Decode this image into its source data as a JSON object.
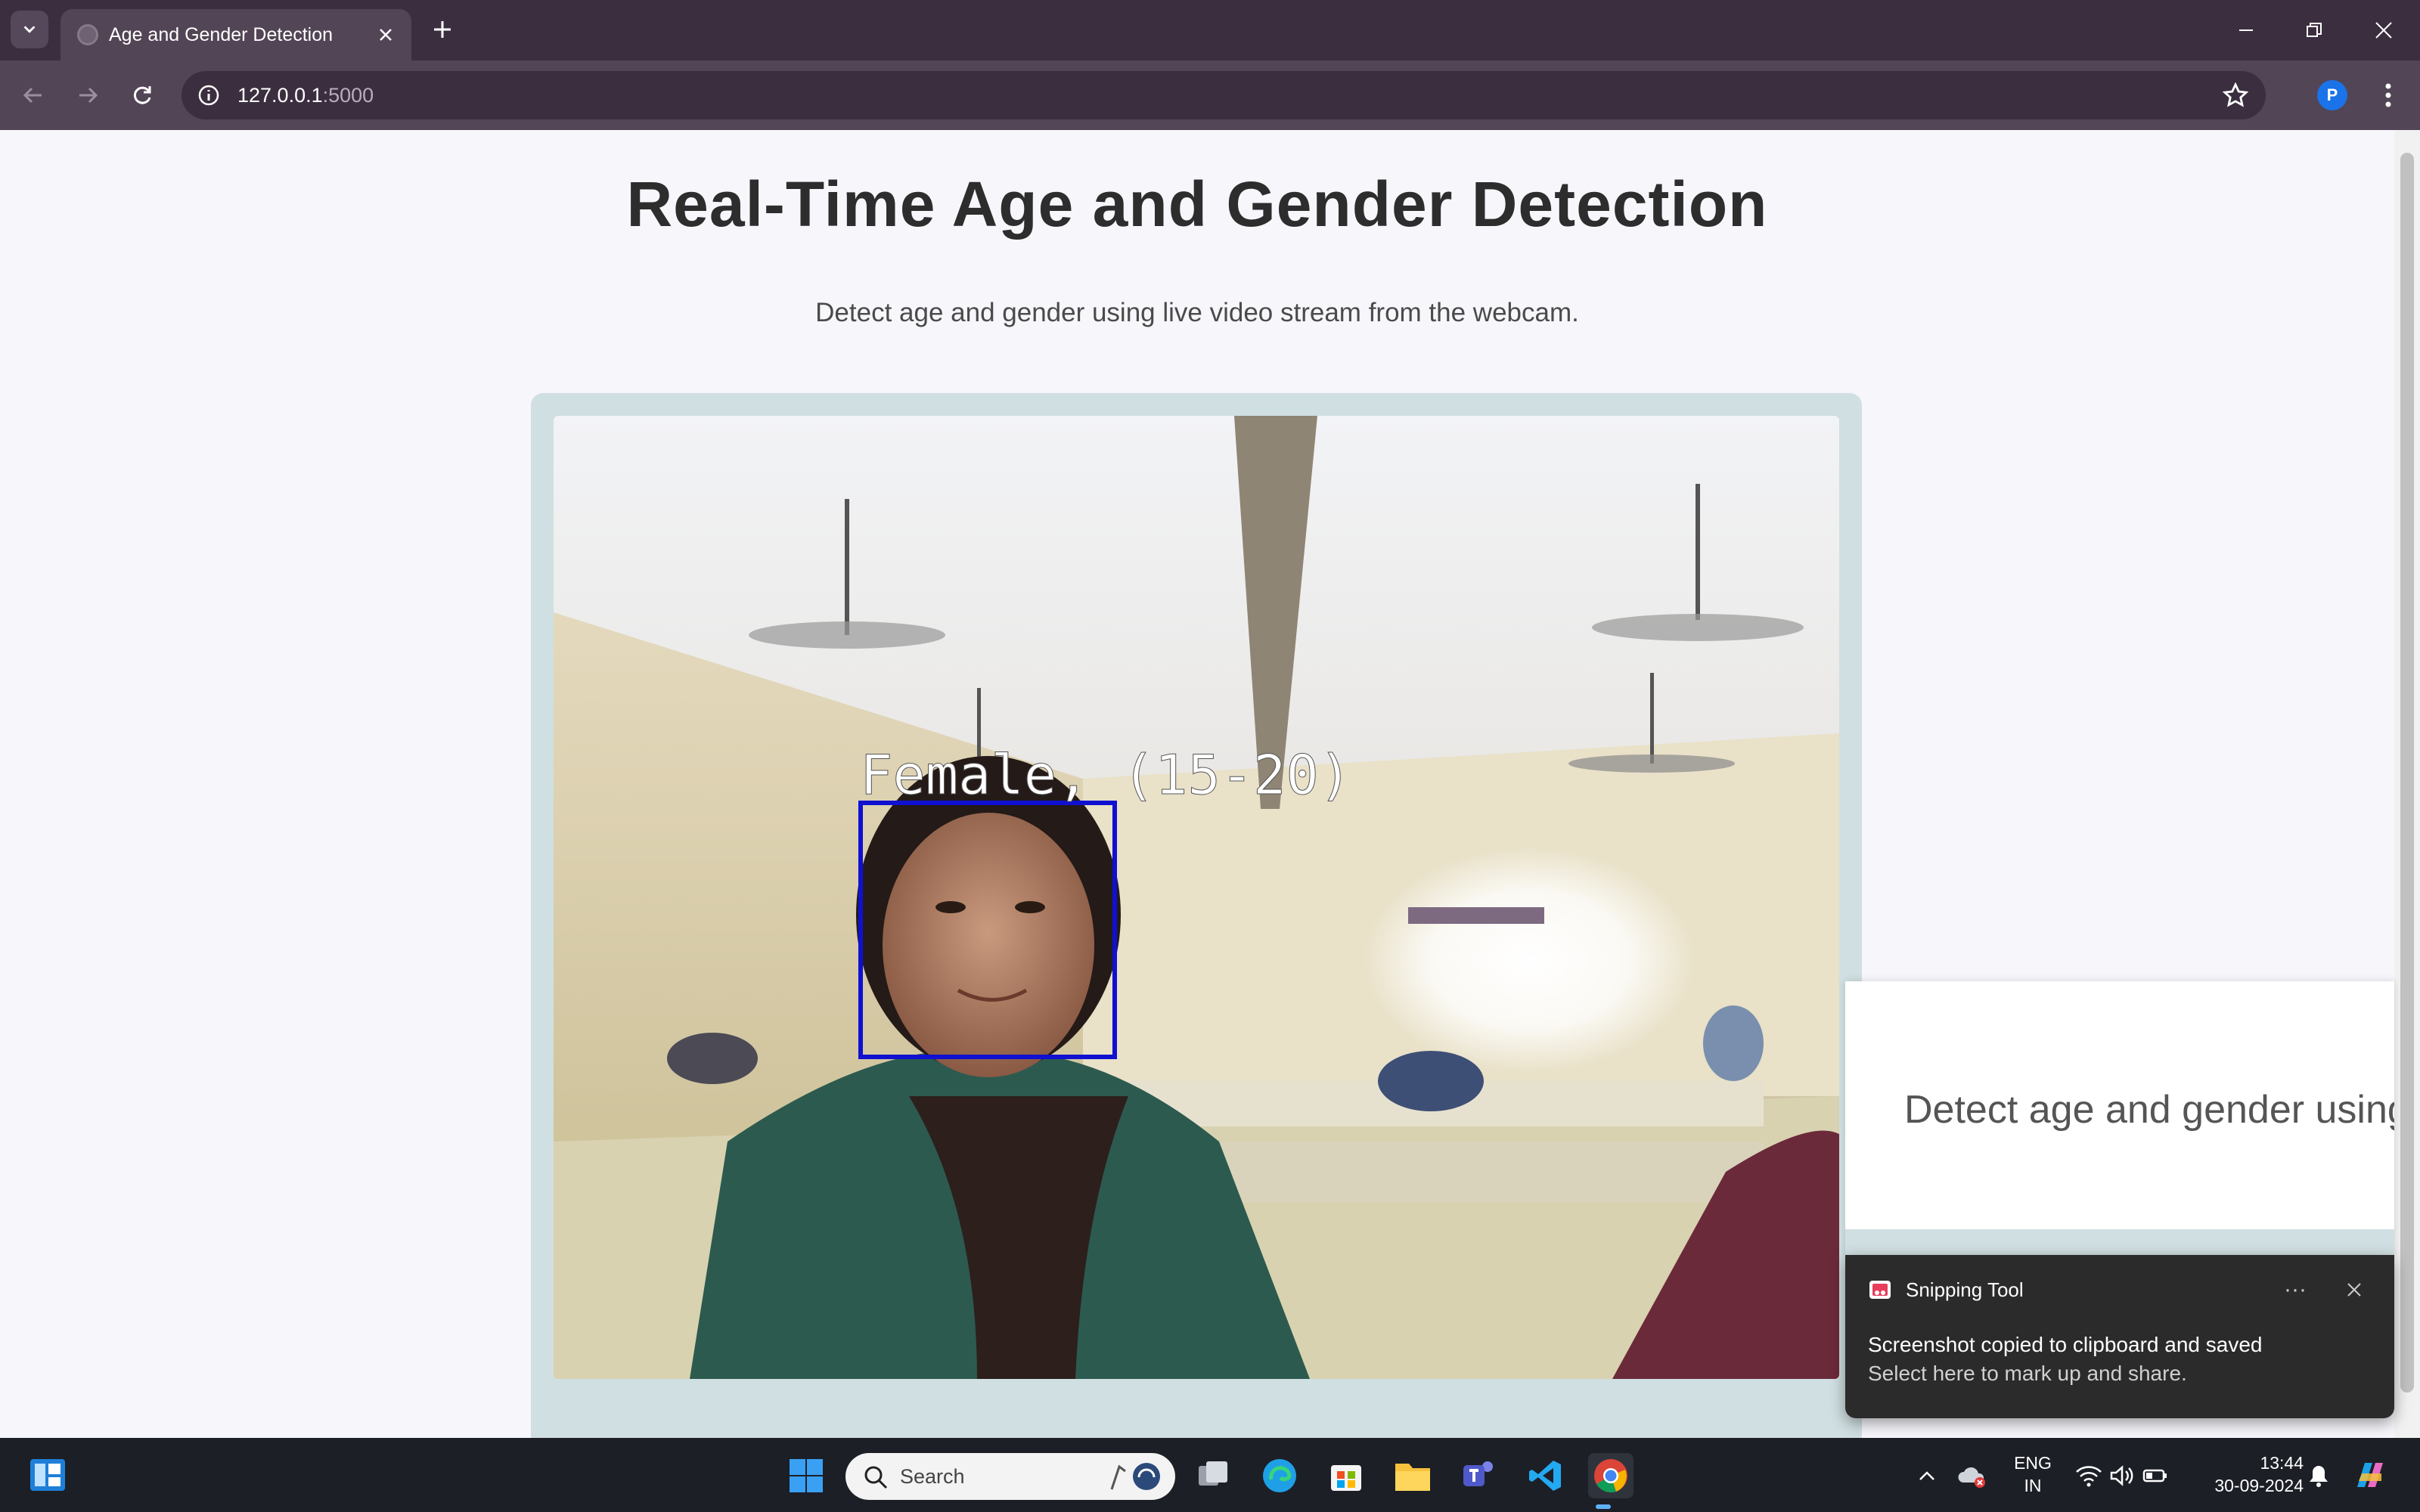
{
  "browser": {
    "tab_title": "Age and Gender Detection",
    "url_host": "127.0.0.1",
    "url_port": ":5000",
    "profile_initial": "P"
  },
  "page": {
    "heading": "Real-Time Age and Gender Detection",
    "subtitle": "Detect age and gender using live video stream from the webcam.",
    "detection_label": "Female, (15-20)",
    "box_color": "#1010d0"
  },
  "toast": {
    "preview_text": "Detect age and gender using",
    "app_name": "Snipping Tool",
    "message": "Screenshot copied to clipboard and saved",
    "sub_message": "Select here to mark up and share.",
    "more_label": "···"
  },
  "taskbar": {
    "search_placeholder": "Search",
    "language_line1": "ENG",
    "language_line2": "IN",
    "time": "13:44",
    "date": "30-09-2024"
  },
  "colors": {
    "titlebar": "#3b2f3f",
    "toolbar": "#524555",
    "page_background": "#f7f6fb",
    "video_frame": "#d0dfe2",
    "taskbar": "#1c1f26"
  }
}
